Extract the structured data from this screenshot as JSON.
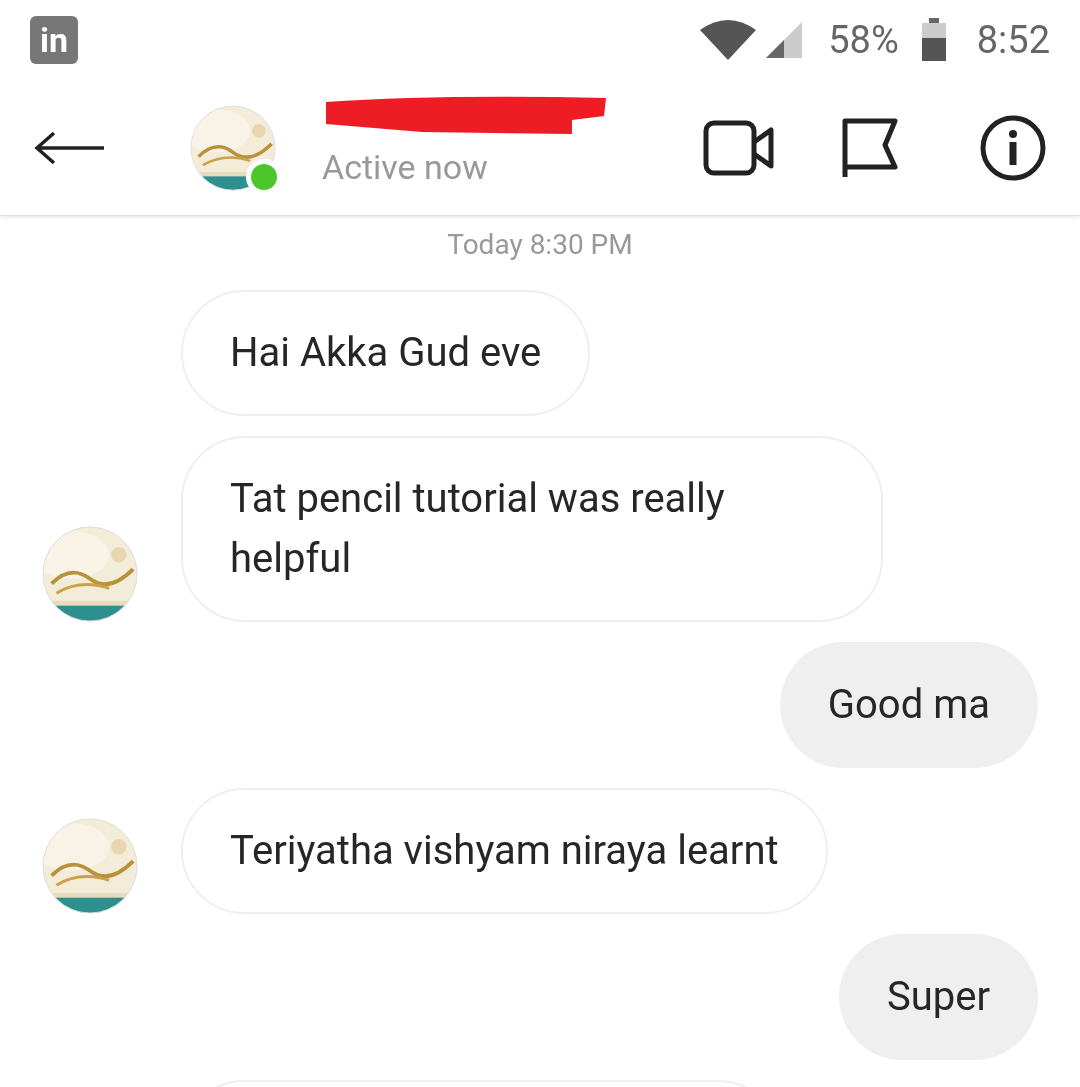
{
  "status_bar": {
    "notification_icon": "in",
    "battery": "58%",
    "time": "8:52"
  },
  "header": {
    "status": "Active now",
    "online": true
  },
  "timestamp": "Today 8:30 PM",
  "messages": [
    {
      "kind": "received",
      "text": "Hai Akka Gud eve",
      "avatar": false
    },
    {
      "kind": "received",
      "text": "Tat pencil tutorial was really helpful",
      "avatar": true
    },
    {
      "kind": "sent",
      "text": "Good ma"
    },
    {
      "kind": "received",
      "text": "Teriyatha vishyam niraya learnt",
      "avatar": true
    },
    {
      "kind": "sent",
      "text": "Super"
    },
    {
      "kind": "partial"
    }
  ]
}
